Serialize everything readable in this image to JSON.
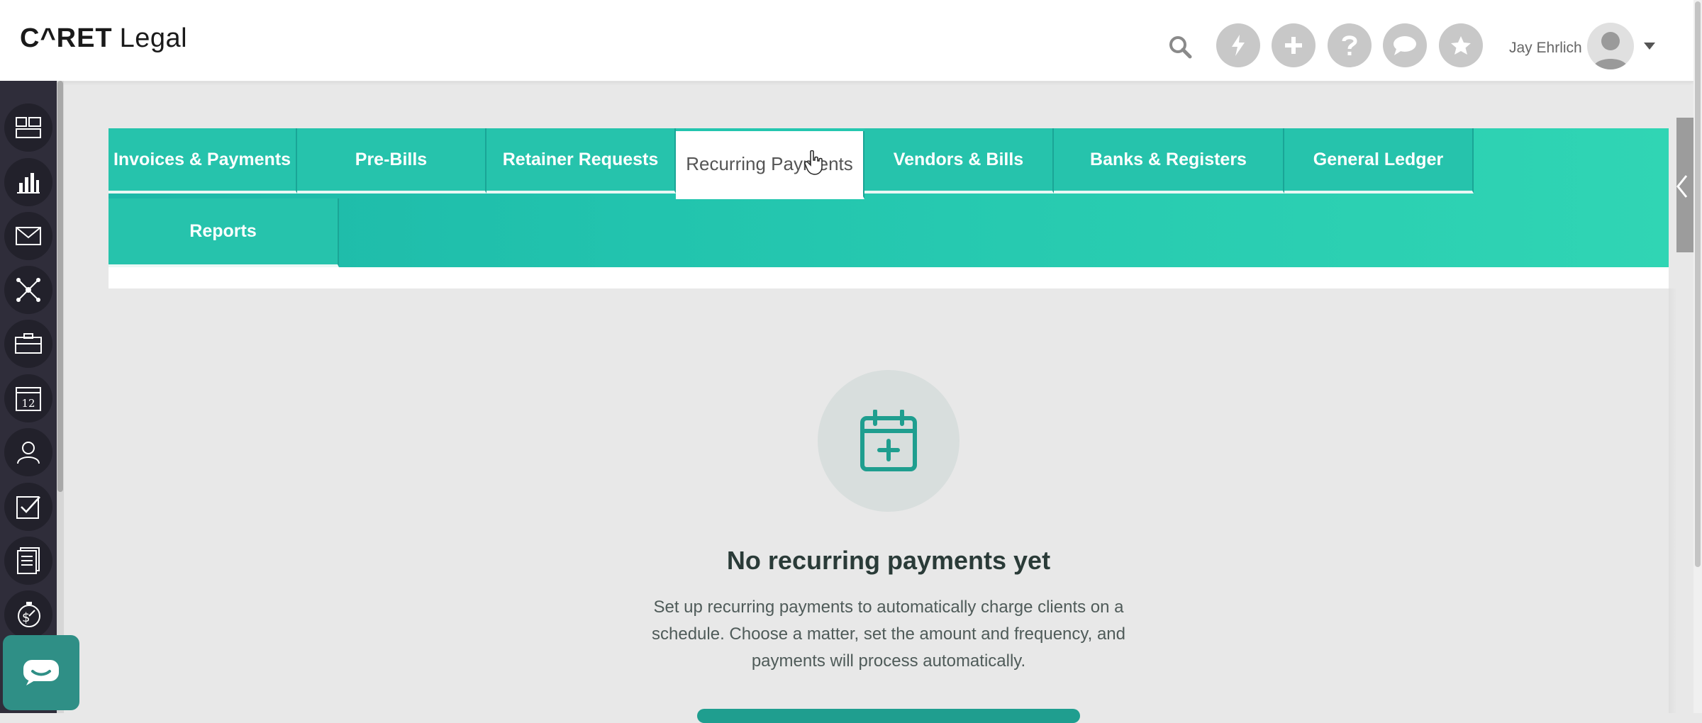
{
  "header": {
    "logo_text_brand": "C^RET",
    "logo_text_product": "Legal",
    "user_name": "Jay Ehrlich",
    "icons": [
      "search-icon",
      "lightning-icon",
      "plus-icon",
      "question-icon",
      "chat-bubble-icon",
      "star-icon"
    ]
  },
  "sidebar": {
    "items": [
      {
        "icon": "dashboard-icon"
      },
      {
        "icon": "bar-chart-icon"
      },
      {
        "icon": "mail-icon"
      },
      {
        "icon": "network-icon"
      },
      {
        "icon": "briefcase-icon"
      },
      {
        "icon": "calendar-icon",
        "label": "12"
      },
      {
        "icon": "contacts-icon"
      },
      {
        "icon": "checkbox-icon"
      },
      {
        "icon": "documents-icon"
      },
      {
        "icon": "billing-timer-icon"
      }
    ]
  },
  "tabs": {
    "invoices": "Invoices & Payments",
    "prebills": "Pre-Bills",
    "retainer": "Retainer Requests",
    "recurring": "Recurring Payments",
    "vendors": "Vendors & Bills",
    "banks": "Banks & Registers",
    "ledger": "General Ledger",
    "reports": "Reports",
    "active": "Recurring Payments"
  },
  "empty_state": {
    "icon": "calendar-plus-icon",
    "title": "No recurring payments yet",
    "description": "Set up recurring payments to automatically charge clients on a schedule. Choose a matter, set the amount and frequency, and payments will process automatically."
  },
  "colors": {
    "accent": "#26c3ac",
    "sidebar_bg": "#2f2d3a",
    "icon_teal": "#1f9e8f"
  }
}
